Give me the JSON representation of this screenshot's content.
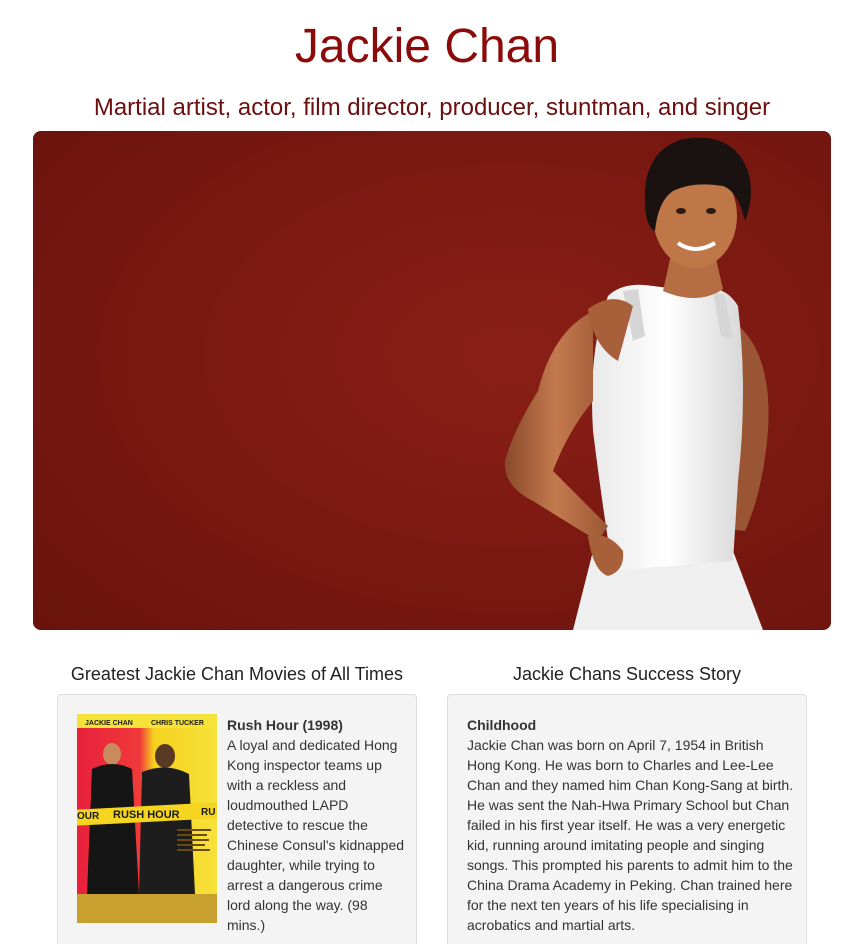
{
  "header": {
    "title": "Jackie Chan",
    "subtitle": "Martial artist, actor, film director, producer, stuntman, and singer"
  },
  "colors": {
    "title": "#8b0a0a",
    "hero_background": "#761811",
    "panel_background": "#f4f4f4"
  },
  "movies_section": {
    "heading": "Greatest Jackie Chan Movies of All Times",
    "items": [
      {
        "title": "Rush Hour (1998)",
        "description": "A loyal and dedicated Hong Kong inspector teams up with a reckless and loudmouthed LAPD detective to rescue the Chinese Consul's kidnapped daughter, while trying to arrest a dangerous crime lord along the way. (98 mins.)",
        "poster": {
          "top_left": "JACKIE CHAN",
          "top_right": "CHRIS TUCKER",
          "tape_left": "OUR",
          "tape_title": "RUSH HOUR",
          "tape_right": "RU"
        }
      }
    ]
  },
  "story_section": {
    "heading": "Jackie Chans Success Story",
    "entries": [
      {
        "heading": "Childhood",
        "text": "Jackie Chan was born on April 7, 1954 in British Hong Kong. He was born to Charles and Lee-Lee Chan and they named him Chan Kong-Sang at birth. He was sent the Nah-Hwa Primary School but Chan failed in his first year itself. He was a very energetic kid, running around imitating people and singing songs. This prompted his parents to admit him to the China Drama Academy in Peking. Chan trained here for the next ten years of his life specialising in acrobatics and martial arts."
      }
    ]
  }
}
